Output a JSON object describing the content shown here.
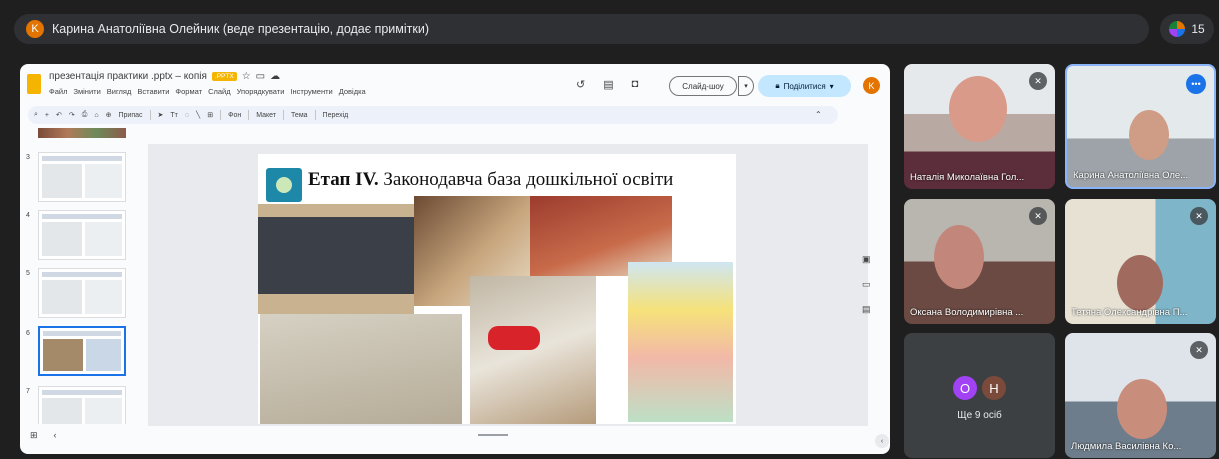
{
  "meeting": {
    "presenter_initial": "K",
    "presenter_text": "Карина Анатоліївна Олейник (веде презентацію, додає примітки)",
    "participant_count": "15"
  },
  "slides_app": {
    "doc_title": "презентація практики .pptx – копія",
    "doc_badge": ".PPTX",
    "menu": [
      "Файл",
      "Змінити",
      "Вигляд",
      "Вставити",
      "Формат",
      "Слайд",
      "Упорядкувати",
      "Інструменти",
      "Довідка"
    ],
    "slideshow_label": "Слайд-шоу",
    "share_label": "Поділитися",
    "user_initial": "K",
    "toolbar": {
      "zoom": "Припас",
      "bg": "Фон",
      "layout": "Макет",
      "theme": "Тема",
      "transition": "Перехід"
    },
    "thumbnails": [
      "3",
      "4",
      "5",
      "6",
      "7"
    ],
    "selected_thumbnail": "6"
  },
  "slide": {
    "title_bold": "Етап IV.",
    "title_rest": " Законодавча база дошкільної освіти"
  },
  "participants": [
    {
      "name": "Наталія Миколаївна Гол...",
      "muted": true
    },
    {
      "name": "Карина Анатоліївна Оле...",
      "muted": false
    },
    {
      "name": "Оксана Володимирівна ...",
      "muted": true
    },
    {
      "name": "Тетяна Олександрівна П...",
      "muted": true
    },
    {
      "name": "Людмила Василівна Ко...",
      "muted": true
    }
  ],
  "others": {
    "initials": [
      "О",
      "Н"
    ],
    "label": "Ще 9 осіб"
  },
  "colors": {
    "accent": "#1a73e8",
    "share_bg": "#c2e7ff",
    "badge": "#f4b400"
  }
}
